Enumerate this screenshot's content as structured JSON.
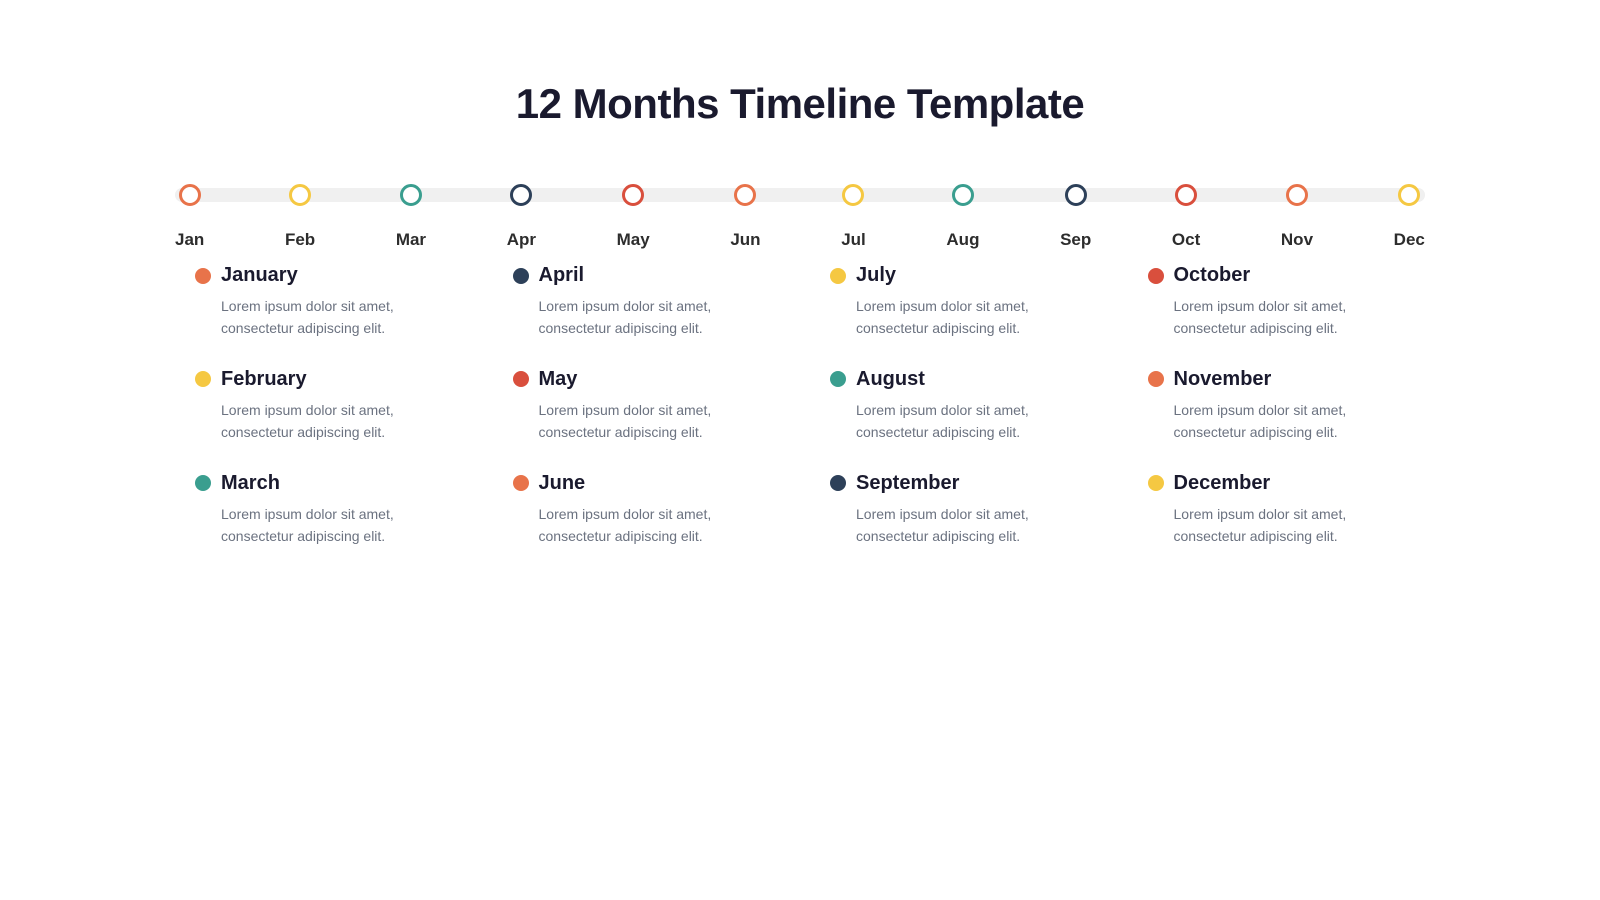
{
  "title": "12 Months Timeline Template",
  "timeline": {
    "months_short": [
      "Jan",
      "Feb",
      "Mar",
      "Apr",
      "May",
      "Jun",
      "Jul",
      "Aug",
      "Sep",
      "Oct",
      "Nov",
      "Dec"
    ],
    "dot_colors": [
      "orange",
      "yellow",
      "teal",
      "dark",
      "red",
      "orange",
      "yellow",
      "teal",
      "dark",
      "red",
      "orange",
      "yellow"
    ]
  },
  "entries": [
    {
      "name": "January",
      "color": "orange",
      "desc": "Lorem ipsum dolor sit amet, consectetur adipiscing elit."
    },
    {
      "name": "February",
      "color": "yellow",
      "desc": "Lorem ipsum dolor sit amet, consectetur adipiscing elit."
    },
    {
      "name": "March",
      "color": "teal",
      "desc": "Lorem ipsum dolor sit amet, consectetur adipiscing elit."
    },
    {
      "name": "April",
      "color": "dark",
      "desc": "Lorem ipsum dolor sit amet, consectetur adipiscing elit."
    },
    {
      "name": "May",
      "color": "red",
      "desc": "Lorem ipsum dolor sit amet, consectetur adipiscing elit."
    },
    {
      "name": "June",
      "color": "orange",
      "desc": "Lorem ipsum dolor sit amet, consectetur adipiscing elit."
    },
    {
      "name": "July",
      "color": "yellow",
      "desc": "Lorem ipsum dolor sit amet, consectetur adipiscing elit."
    },
    {
      "name": "August",
      "color": "teal",
      "desc": "Lorem ipsum dolor sit amet, consectetur adipiscing elit."
    },
    {
      "name": "September",
      "color": "dark",
      "desc": "Lorem ipsum dolor sit amet, consectetur adipiscing elit."
    },
    {
      "name": "October",
      "color": "red",
      "desc": "Lorem ipsum dolor sit amet, consectetur adipiscing elit."
    },
    {
      "name": "November",
      "color": "orange",
      "desc": "Lorem ipsum dolor sit amet, consectetur adipiscing elit."
    },
    {
      "name": "December",
      "color": "yellow",
      "desc": "Lorem ipsum dolor sit amet, consectetur adipiscing elit."
    }
  ],
  "grid_order": [
    0,
    3,
    6,
    9,
    1,
    4,
    7,
    10,
    2,
    5,
    8,
    11
  ]
}
